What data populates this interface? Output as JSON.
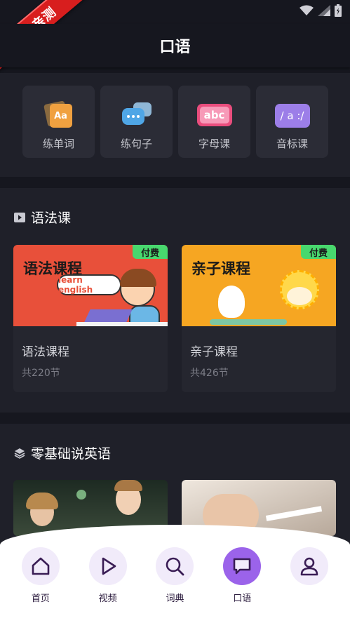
{
  "ribbon": {
    "text": "乐乐亲测"
  },
  "header": {
    "title": "口语"
  },
  "quick_actions": [
    {
      "label": "练单词",
      "icon": "word-cards-icon"
    },
    {
      "label": "练句子",
      "icon": "chat-bubbles-icon"
    },
    {
      "label": "字母课",
      "icon": "abc-icon"
    },
    {
      "label": "音标课",
      "icon": "phonetic-icon"
    }
  ],
  "grammar": {
    "title": "语法课",
    "cards": [
      {
        "image_title": "语法课程",
        "bubble": "learn english",
        "badge": "付费",
        "title": "语法课程",
        "count": "共220节"
      },
      {
        "image_title": "亲子课程",
        "badge": "付费",
        "title": "亲子课程",
        "count": "共426节"
      }
    ]
  },
  "basics": {
    "title": "零基础说英语"
  },
  "tabs": [
    {
      "label": "首页",
      "icon": "home-icon",
      "active": false
    },
    {
      "label": "视频",
      "icon": "play-icon",
      "active": false
    },
    {
      "label": "词典",
      "icon": "search-icon",
      "active": false
    },
    {
      "label": "口语",
      "icon": "message-icon",
      "active": true
    },
    {
      "label": "",
      "icon": "user-icon",
      "active": false
    }
  ],
  "colors": {
    "accent": "#9b63ea",
    "badge": "#48d86e",
    "background": "#16171f"
  }
}
